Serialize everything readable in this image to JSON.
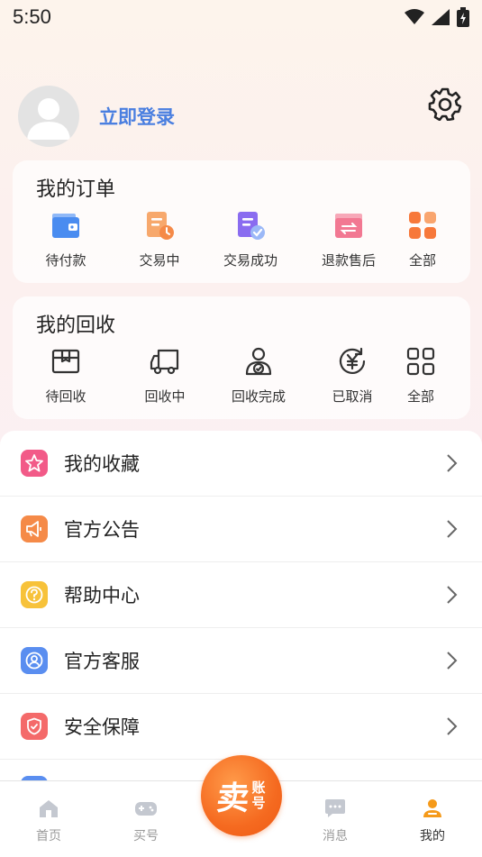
{
  "status_bar": {
    "time": "5:50"
  },
  "profile": {
    "login_label": "立即登录"
  },
  "orders": {
    "title": "我的订单",
    "items": [
      {
        "label": "待付款",
        "icon": "wallet-icon",
        "color": "#4a8cf0"
      },
      {
        "label": "交易中",
        "icon": "document-clock-icon",
        "color": "#f79a5a"
      },
      {
        "label": "交易成功",
        "icon": "document-check-icon",
        "color": "#8a6cf0"
      },
      {
        "label": "退款售后",
        "icon": "refund-icon",
        "color": "#f27892"
      },
      {
        "label": "全部",
        "icon": "grid-icon",
        "color": "#f7783a"
      }
    ]
  },
  "recycle": {
    "title": "我的回收",
    "items": [
      {
        "label": "待回收",
        "icon": "box-icon"
      },
      {
        "label": "回收中",
        "icon": "truck-icon"
      },
      {
        "label": "回收完成",
        "icon": "person-check-icon"
      },
      {
        "label": "已取消",
        "icon": "yen-refresh-icon"
      },
      {
        "label": "全部",
        "icon": "grid-outline-icon"
      }
    ]
  },
  "menu": [
    {
      "label": "我的收藏",
      "icon": "star-icon",
      "color": "#f25a88"
    },
    {
      "label": "官方公告",
      "icon": "megaphone-icon",
      "color": "#f58a48"
    },
    {
      "label": "帮助中心",
      "icon": "question-icon",
      "color": "#f7c23a"
    },
    {
      "label": "官方客服",
      "icon": "support-icon",
      "color": "#5a8ef0"
    },
    {
      "label": "安全保障",
      "icon": "shield-check-icon",
      "color": "#f46a6a"
    }
  ],
  "tabbar": {
    "items": [
      {
        "label": "首页",
        "icon": "home-icon"
      },
      {
        "label": "买号",
        "icon": "gamepad-icon"
      },
      {
        "label": "消息",
        "icon": "chat-icon"
      },
      {
        "label": "我的",
        "icon": "user-icon"
      }
    ],
    "active": "我的",
    "sell_main": "卖",
    "sell_sub_1": "账",
    "sell_sub_2": "号"
  }
}
